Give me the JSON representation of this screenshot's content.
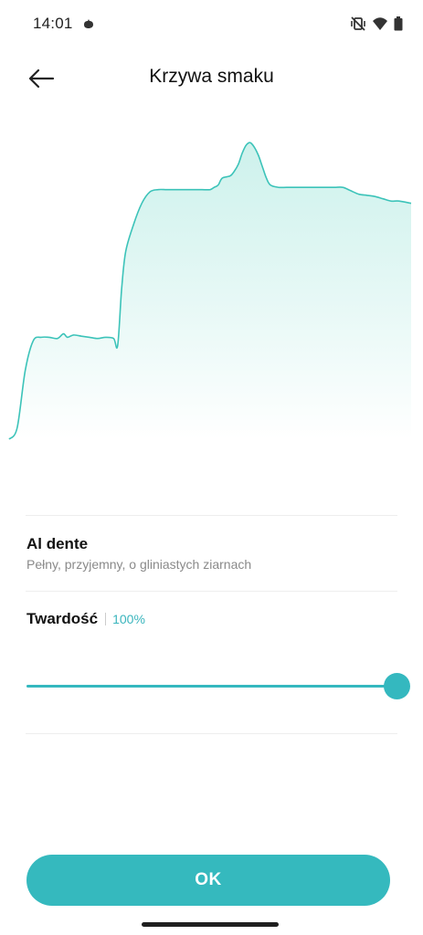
{
  "status_bar": {
    "time": "14:01",
    "icons": [
      "cat-notification-icon",
      "vibrate-off-icon",
      "wifi-icon",
      "battery-icon"
    ]
  },
  "header": {
    "title": "Krzywa smaku",
    "back_icon": "arrow-left-icon"
  },
  "profile": {
    "name": "Al dente",
    "description": "Pełny, przyjemny, o gliniastych ziarnach"
  },
  "hardness": {
    "label": "Twardość",
    "value_text": "100%",
    "value": 1.0
  },
  "ok_button": {
    "label": "OK"
  },
  "colors": {
    "accent": "#35b9be",
    "curve": "#3cc3b9",
    "fill_top": "#c8f0ea",
    "secondary_text": "#8a8a8a"
  },
  "chart_data": {
    "type": "area",
    "title": "",
    "xlabel": "",
    "ylabel": "",
    "grid": false,
    "xlim": [
      0,
      100
    ],
    "ylim": [
      0,
      100
    ],
    "series": [
      {
        "x": [
          0,
          2,
          4,
          6,
          8,
          10,
          12,
          13.5,
          14.5,
          16,
          18,
          20,
          22,
          24,
          26,
          27,
          28,
          29,
          31,
          33,
          35,
          37,
          39,
          40,
          41,
          42,
          44,
          46,
          48,
          50,
          51,
          52,
          53,
          55,
          56,
          57,
          58,
          59,
          60,
          61,
          62,
          63,
          64,
          65,
          67,
          69,
          71,
          73,
          75,
          77,
          79,
          81,
          83,
          85,
          87,
          89,
          91,
          93,
          95,
          97,
          100
        ],
        "y": [
          0,
          5,
          30,
          43,
          44.5,
          44.5,
          44,
          46,
          44.5,
          45.5,
          45,
          44.5,
          44,
          44.5,
          44,
          41,
          66,
          82,
          94,
          103,
          108,
          109,
          109,
          109,
          109,
          109,
          109,
          109,
          109,
          109,
          110,
          111,
          114,
          115,
          117,
          120,
          125,
          128.5,
          129.5,
          127.5,
          124,
          119,
          114,
          111,
          110,
          110,
          110,
          110,
          110,
          110,
          110,
          110,
          110,
          108.5,
          107,
          106.5,
          106,
          105,
          104,
          104,
          103
        ]
      }
    ]
  }
}
